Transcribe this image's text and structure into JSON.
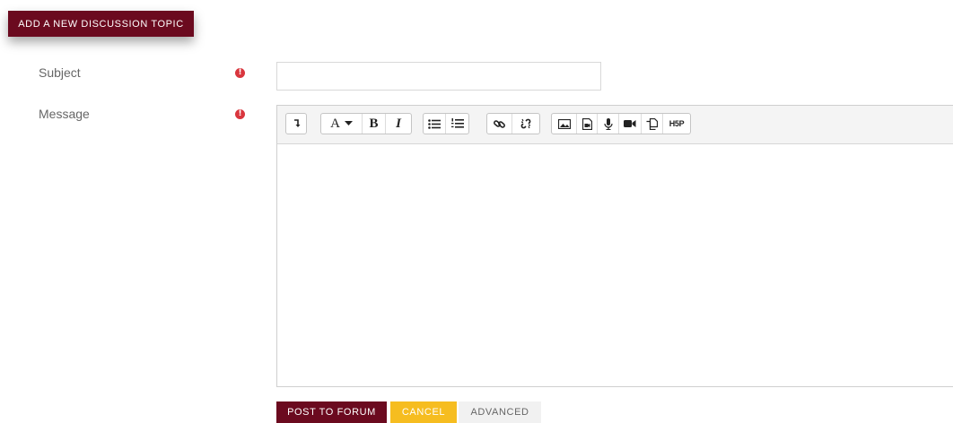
{
  "header": {
    "add_topic_label": "ADD A NEW DISCUSSION TOPIC"
  },
  "form": {
    "subject_label": "Subject",
    "message_label": "Message",
    "required_icon": "exclamation-circle-icon",
    "subject_value": "",
    "message_value": ""
  },
  "toolbar": {
    "groups": [
      {
        "items": [
          "show-more-icon"
        ]
      },
      {
        "items": [
          "font-color-icon",
          "bold-icon",
          "italic-icon"
        ],
        "labels": {
          "font": "A",
          "bold": "B",
          "italic": "I"
        }
      },
      {
        "items": [
          "unordered-list-icon",
          "ordered-list-icon"
        ]
      },
      {
        "items": [
          "link-icon",
          "unlink-icon"
        ]
      },
      {
        "items": [
          "image-icon",
          "media-icon",
          "record-audio-icon",
          "record-video-icon",
          "manage-files-icon",
          "h5p-icon"
        ],
        "h5p_label": "H5P"
      }
    ]
  },
  "actions": {
    "post_label": "POST TO FORUM",
    "cancel_label": "CANCEL",
    "advanced_label": "ADVANCED"
  },
  "colors": {
    "brand": "#6b0a1f",
    "cancel": "#f6bd20",
    "required": "#d9363e"
  }
}
